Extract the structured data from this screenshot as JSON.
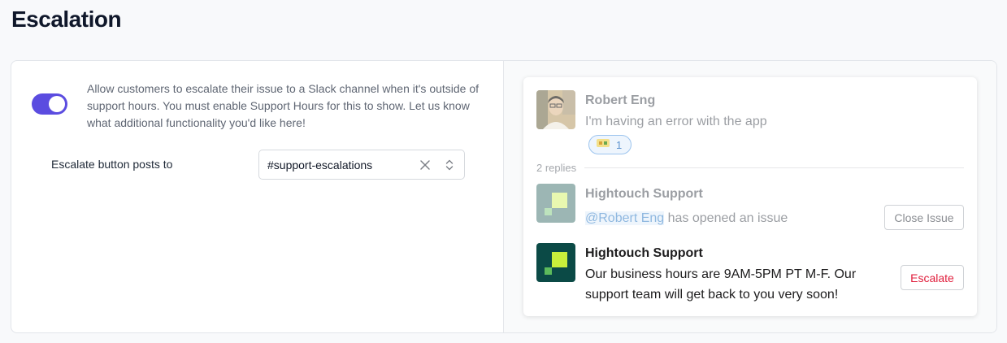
{
  "page": {
    "title": "Escalation"
  },
  "settings": {
    "toggle_enabled": true,
    "description": "Allow customers to escalate their issue to a Slack channel when it's outside of support hours. You must enable Support Hours for this to show. Let us know what additional functionality you'd like here!",
    "field_label": "Escalate button posts to",
    "channel_value": "#support-escalations"
  },
  "preview": {
    "message1": {
      "author": "Robert Eng",
      "text": "I'm having an error with the app",
      "reaction_count": "1"
    },
    "replies_label": "2 replies",
    "message2": {
      "author": "Hightouch Support",
      "mention": "@Robert Eng",
      "text": " has opened an issue",
      "button_label": "Close Issue"
    },
    "message3": {
      "author": "Hightouch Support",
      "text": "Our business hours are 9AM-5PM PT M-F. Our support team will get back to you very soon!",
      "button_label": "Escalate"
    }
  },
  "colors": {
    "accent": "#5b4ce0",
    "escalate_red": "#e01e3c",
    "hightouch_dark": "#0b4a46",
    "hightouch_lime": "#c9ef3b"
  }
}
